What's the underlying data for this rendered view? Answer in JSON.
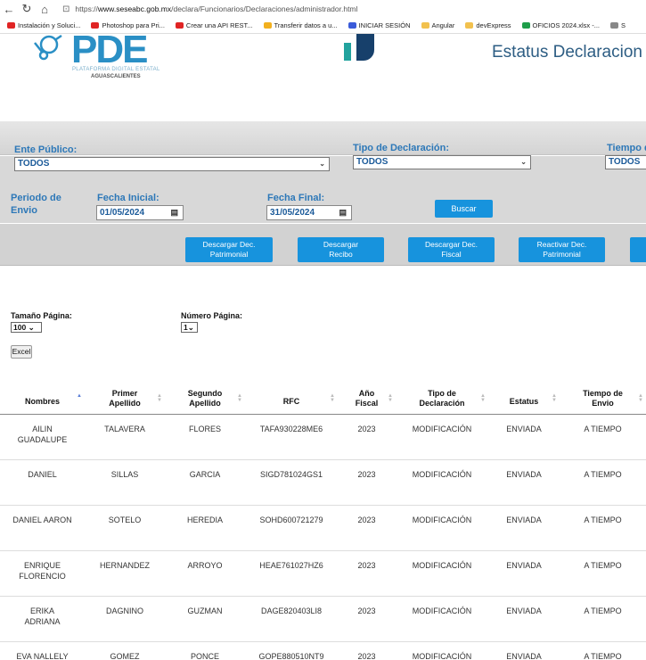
{
  "browser": {
    "url_prefix": "https://",
    "url_host": "www.seseabc.gob.mx",
    "url_path": "/declara/Funcionarios/Declaraciones/administrador.html",
    "bookmarks": [
      {
        "label": "Instalación y Soluci...",
        "color": "#e02424"
      },
      {
        "label": "Photoshop para Pri...",
        "color": "#e02424"
      },
      {
        "label": "Crear una API REST...",
        "color": "#e02424"
      },
      {
        "label": "Transferir datos a u...",
        "color": "#f2b01e"
      },
      {
        "label": "INICIAR SESIÓN",
        "color": "#3a5bd9"
      },
      {
        "label": "Angular",
        "color": "#f2c14e"
      },
      {
        "label": "devExpress",
        "color": "#f2c14e"
      },
      {
        "label": "OFICIOS 2024.xlsx -...",
        "color": "#1e9e4a"
      },
      {
        "label": "S",
        "color": "#888888"
      }
    ]
  },
  "header": {
    "logo_text": "PDE",
    "logo_sub1": "PLATAFORMA DIGITAL ESTATAL",
    "logo_sub2": "AGUASCALIENTES",
    "title": "Estatus Declaracion"
  },
  "filters": {
    "ente_label": "Ente Público:",
    "ente_value": "TODOS",
    "tipo_label": "Tipo de Declaración:",
    "tipo_value": "TODOS",
    "tiempo_label": "Tiempo d",
    "tiempo_value": "TODOS",
    "periodo_label_1": "Periodo de",
    "periodo_label_2": "Envio",
    "fecha_inicial_label": "Fecha Inicial:",
    "fecha_inicial_value": "01/05/2024",
    "fecha_final_label": "Fecha Final:",
    "fecha_final_value": "31/05/2024",
    "buscar_label": "Buscar"
  },
  "actions": {
    "descargar_patrimonial_1": "Descargar Dec.",
    "descargar_patrimonial_2": "Patrimonial",
    "descargar_recibo_1": "Descargar",
    "descargar_recibo_2": "Recibo",
    "descargar_fiscal_1": "Descargar Dec.",
    "descargar_fiscal_2": "Fiscal",
    "reactivar_1": "Reactivar Dec.",
    "reactivar_2": "Patrimonial"
  },
  "pagination": {
    "tamano_label": "Tamaño Página:",
    "tamano_value": "100",
    "numero_label": "Número Página:",
    "numero_value": "1",
    "excel_label": "Excel"
  },
  "table": {
    "headers": [
      {
        "l1": "Nombres",
        "l2": ""
      },
      {
        "l1": "Primer",
        "l2": "Apellido"
      },
      {
        "l1": "Segundo",
        "l2": "Apellido"
      },
      {
        "l1": "RFC",
        "l2": ""
      },
      {
        "l1": "Año",
        "l2": "Fiscal"
      },
      {
        "l1": "Tipo de",
        "l2": "Declaración"
      },
      {
        "l1": "Estatus",
        "l2": ""
      },
      {
        "l1": "Tiempo de",
        "l2": "Envio"
      }
    ],
    "rows": [
      [
        "AILIN GUADALUPE",
        "TALAVERA",
        "FLORES",
        "TAFA930228ME6",
        "2023",
        "MODIFICACIÓN",
        "ENVIADA",
        "A TIEMPO"
      ],
      [
        "DANIEL",
        "SILLAS",
        "GARCIA",
        "SIGD781024GS1",
        "2023",
        "MODIFICACIÓN",
        "ENVIADA",
        "A TIEMPO"
      ],
      [
        "DANIEL AARON",
        "SOTELO",
        "HEREDIA",
        "SOHD600721279",
        "2023",
        "MODIFICACIÓN",
        "ENVIADA",
        "A TIEMPO"
      ],
      [
        "ENRIQUE FLORENCIO",
        "HERNANDEZ",
        "ARROYO",
        "HEAE761027HZ6",
        "2023",
        "MODIFICACIÓN",
        "ENVIADA",
        "A TIEMPO"
      ],
      [
        "ERIKA ADRIANA",
        "DAGNINO",
        "GUZMAN",
        "DAGE820403LI8",
        "2023",
        "MODIFICACIÓN",
        "ENVIADA",
        "A TIEMPO"
      ],
      [
        "EVA NALLELY",
        "GOMEZ",
        "PONCE",
        "GOPE880510NT9",
        "2023",
        "MODIFICACIÓN",
        "ENVIADA",
        "A TIEMPO"
      ]
    ]
  }
}
